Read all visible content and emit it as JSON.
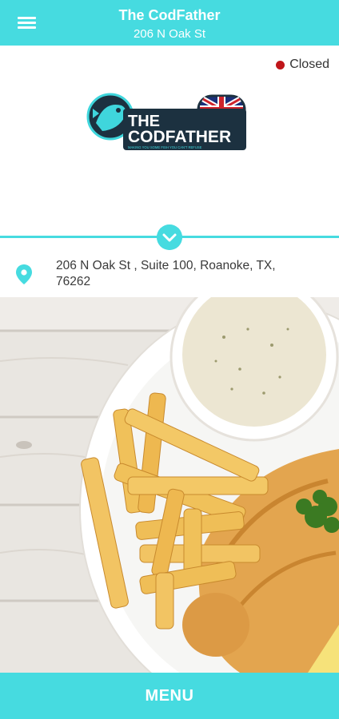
{
  "header": {
    "title": "The CodFather",
    "subtitle": "206 N Oak St"
  },
  "status": {
    "label": "Closed",
    "color": "#c0161a"
  },
  "logo": {
    "line1": "THE",
    "line2": "CODFATHER",
    "tagline": "MAKING YOU SOME FISH YOU CAN'T REFUSE"
  },
  "location": {
    "address": "206 N Oak St , Suite 100, Roanoke, TX, 76262"
  },
  "footer": {
    "menu_label": "MENU"
  },
  "colors": {
    "accent": "#46dbe0"
  }
}
